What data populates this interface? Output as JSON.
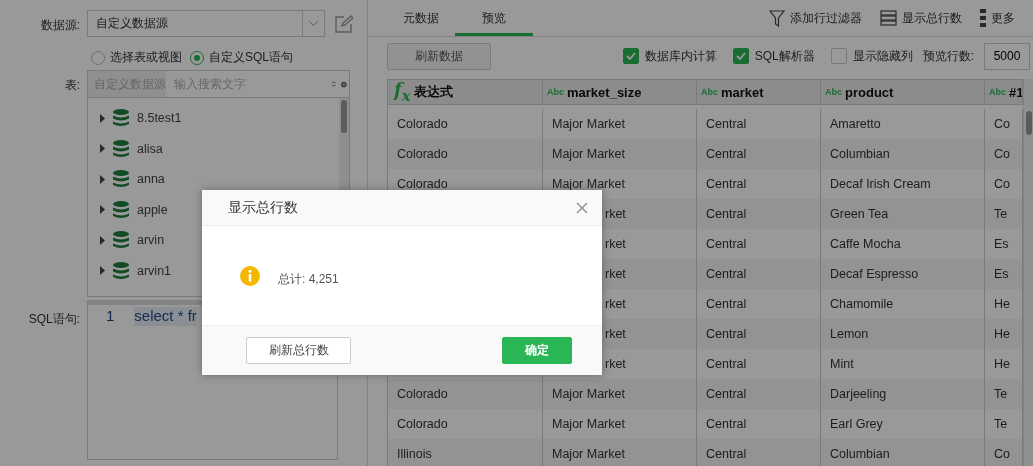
{
  "datasource": {
    "label": "数据源:",
    "value": "自定义数据源"
  },
  "source_modes": [
    {
      "label": "选择表或视图",
      "selected": false
    },
    {
      "label": "自定义SQL语句",
      "selected": true
    }
  ],
  "table_picker": {
    "label": "表:",
    "source_tab": "自定义数据源",
    "placeholder": "输入搜索文字",
    "items": [
      {
        "name": "8.5test1"
      },
      {
        "name": "alisa"
      },
      {
        "name": "anna"
      },
      {
        "name": "apple"
      },
      {
        "name": "arvin"
      },
      {
        "name": "arvin1"
      }
    ]
  },
  "sql": {
    "label": "SQL语句:",
    "line_number": "1",
    "code": "select * fr"
  },
  "tabs": [
    {
      "label": "元数据",
      "selected": false
    },
    {
      "label": "预览",
      "selected": true
    }
  ],
  "actions": [
    {
      "kind": "filter",
      "label": "添加行过滤器"
    },
    {
      "kind": "rows",
      "label": "显示总行数"
    },
    {
      "kind": "more",
      "label": "更多"
    }
  ],
  "refresh_button": "刷新数据",
  "options": [
    {
      "label": "数据库内计算",
      "checked": true
    },
    {
      "label": "SQL解析器",
      "checked": true
    },
    {
      "label": "显示隐藏列",
      "checked": false
    }
  ],
  "preview_rows": {
    "label": "预览行数:",
    "value": "5000"
  },
  "table": {
    "columns": [
      {
        "kind": "expression",
        "badge": "f$_{x}$",
        "name": "表达式"
      },
      {
        "kind": "text",
        "badge": "Abc",
        "name": "market_size"
      },
      {
        "kind": "text",
        "badge": "Abc",
        "name": "market"
      },
      {
        "kind": "text",
        "badge": "Abc",
        "name": "product"
      },
      {
        "kind": "text",
        "badge": "Abc",
        "name": "#1"
      }
    ],
    "rows": [
      [
        "Colorado",
        "Major Market",
        "Central",
        "Amaretto",
        "Co"
      ],
      [
        "Colorado",
        "Major Market",
        "Central",
        "Columbian",
        "Co"
      ],
      [
        "Colorado",
        "Major Market",
        "Central",
        "Decaf Irish Cream",
        "Co"
      ],
      [
        null,
        {
          "kind": "covered",
          "text": "rket"
        },
        "Central",
        "Green Tea",
        "Te"
      ],
      [
        null,
        {
          "kind": "covered",
          "text": "rket"
        },
        "Central",
        "Caffe Mocha",
        "Es"
      ],
      [
        null,
        {
          "kind": "covered",
          "text": "rket"
        },
        "Central",
        "Decaf Espresso",
        "Es"
      ],
      [
        null,
        {
          "kind": "covered",
          "text": "rket"
        },
        "Central",
        "Chamomile",
        "He"
      ],
      [
        null,
        {
          "kind": "covered",
          "text": "rket"
        },
        "Central",
        "Lemon",
        "He"
      ],
      [
        null,
        {
          "kind": "covered",
          "text": "rket"
        },
        "Central",
        "Mint",
        "He"
      ],
      [
        "Colorado",
        "Major Market",
        "Central",
        "Darjeeling",
        "Te"
      ],
      [
        "Colorado",
        "Major Market",
        "Central",
        "Earl Grey",
        "Te"
      ],
      [
        "Illinois",
        "Major Market",
        "Central",
        "Columbian",
        "Co"
      ]
    ]
  },
  "dialog": {
    "title": "显示总行数",
    "message": "总计: 4,251",
    "secondary_button": "刷新总行数",
    "primary_button": "确定"
  }
}
